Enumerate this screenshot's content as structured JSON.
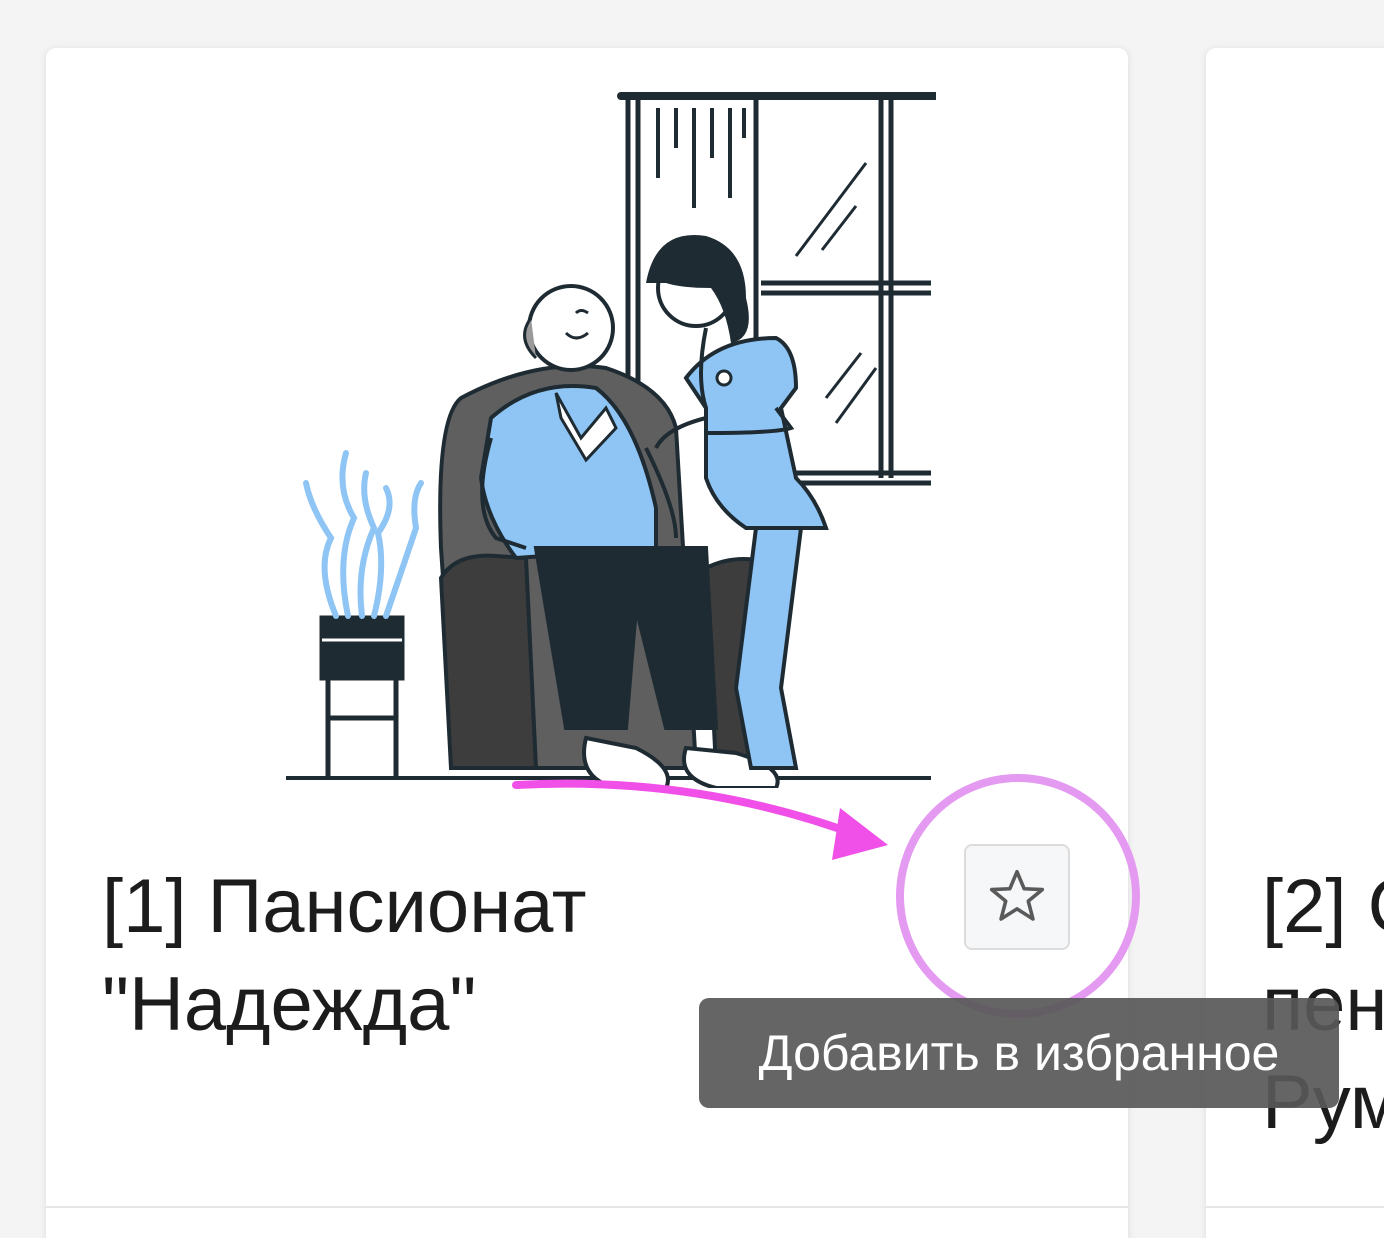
{
  "cards": [
    {
      "title": "[1] Пансионат \"Надежда\"",
      "favorite_button": {
        "icon": "star-outline-icon"
      }
    },
    {
      "title_lines": [
        "[2] С",
        "пен",
        "Рум"
      ]
    }
  ],
  "tooltip": {
    "text": "Добавить в избранное"
  },
  "annotation": {
    "arrow_color": "#f050e8",
    "highlight_circle_color": "#e59af2"
  },
  "illustration": {
    "subject": "nurse-with-elderly-man-illustration",
    "colors": {
      "light_blue": "#8ec5f5",
      "dark_navy": "#1f2b33",
      "armchair_gray": "#5f5f5f",
      "outline": "#1f2b33"
    }
  }
}
